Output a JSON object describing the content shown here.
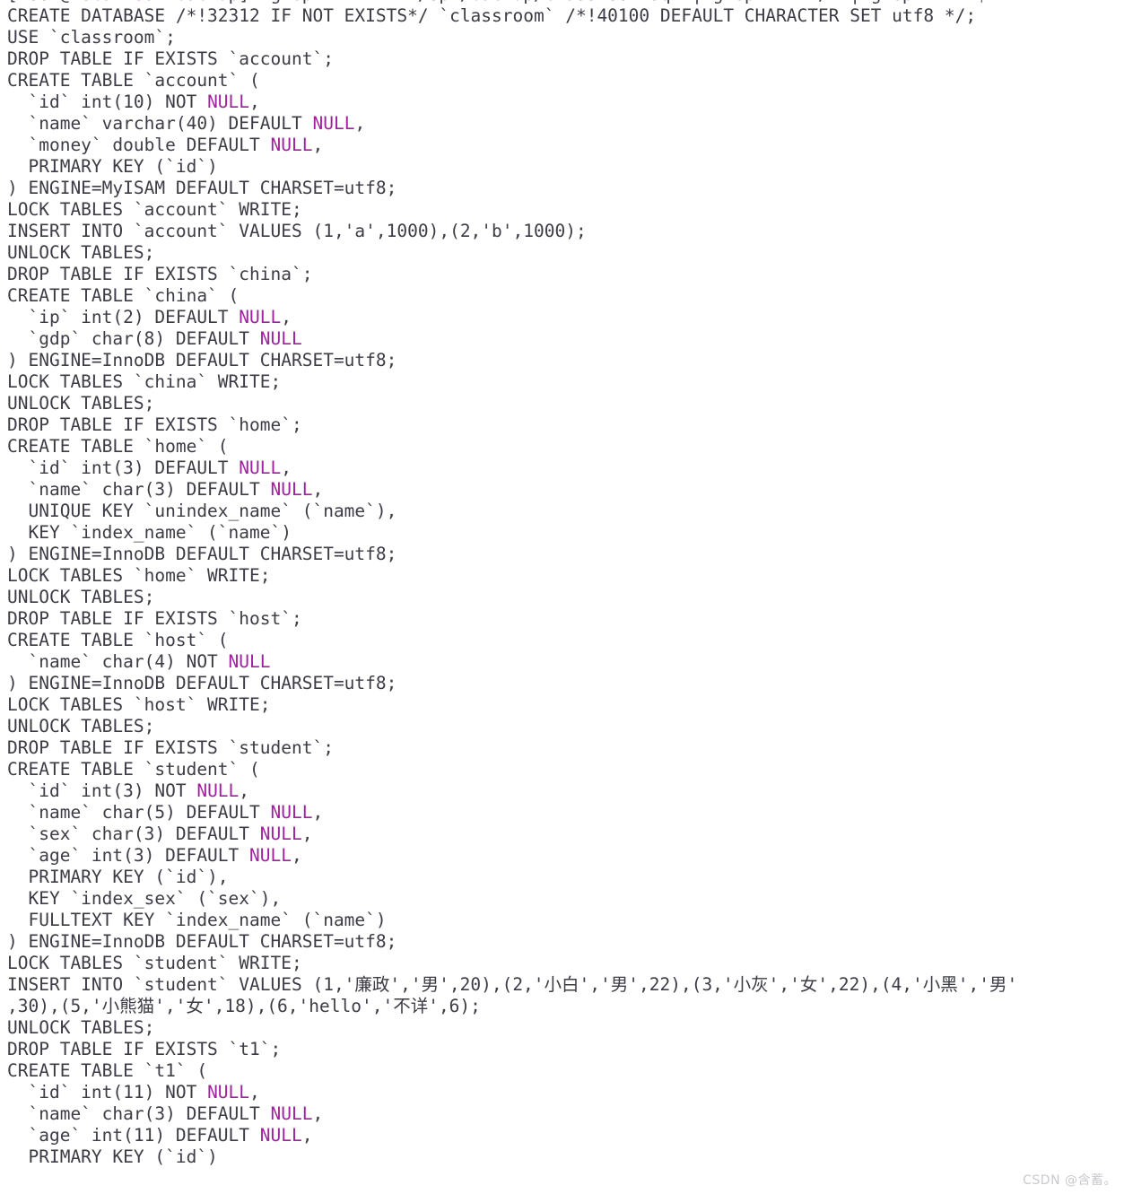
{
  "terminal": {
    "colors": {
      "background": "#ffffff",
      "foreground": "#3c3c46",
      "keyword_magenta": "#a0219f",
      "watermark": "#c9c9cf"
    },
    "prompt": {
      "user": "root",
      "host": "localhost",
      "cwd": "backup",
      "symbol": "#",
      "full_prompt": "[root@localhost backup]# ",
      "command": "grep -v \"^--\" /opt/backup/classroom.sql | grep -v \"^/\" | grep -v \"^$\""
    },
    "clipped_top_line": "",
    "lines": [
      {
        "text": "[root@localhost backup]# grep -v \"^--\" /opt/backup/classroom.sql | grep -v \"^/\" | grep -v \"^$\"",
        "highlight": [
          "localhost"
        ]
      },
      {
        "text": "CREATE DATABASE /*!32312 IF NOT EXISTS*/ `classroom` /*!40100 DEFAULT CHARACTER SET utf8 */;",
        "highlight": []
      },
      {
        "text": "USE `classroom`;",
        "highlight": []
      },
      {
        "text": "DROP TABLE IF EXISTS `account`;",
        "highlight": []
      },
      {
        "text": "CREATE TABLE `account` (",
        "highlight": []
      },
      {
        "text": "  `id` int(10) NOT NULL,",
        "highlight": [
          "NULL"
        ]
      },
      {
        "text": "  `name` varchar(40) DEFAULT NULL,",
        "highlight": [
          "NULL"
        ]
      },
      {
        "text": "  `money` double DEFAULT NULL,",
        "highlight": [
          "NULL"
        ]
      },
      {
        "text": "  PRIMARY KEY (`id`)",
        "highlight": []
      },
      {
        "text": ") ENGINE=MyISAM DEFAULT CHARSET=utf8;",
        "highlight": []
      },
      {
        "text": "LOCK TABLES `account` WRITE;",
        "highlight": []
      },
      {
        "text": "INSERT INTO `account` VALUES (1,'a',1000),(2,'b',1000);",
        "highlight": []
      },
      {
        "text": "UNLOCK TABLES;",
        "highlight": []
      },
      {
        "text": "DROP TABLE IF EXISTS `china`;",
        "highlight": []
      },
      {
        "text": "CREATE TABLE `china` (",
        "highlight": []
      },
      {
        "text": "  `ip` int(2) DEFAULT NULL,",
        "highlight": [
          "NULL"
        ]
      },
      {
        "text": "  `gdp` char(8) DEFAULT NULL",
        "highlight": [
          "NULL"
        ]
      },
      {
        "text": ") ENGINE=InnoDB DEFAULT CHARSET=utf8;",
        "highlight": []
      },
      {
        "text": "LOCK TABLES `china` WRITE;",
        "highlight": []
      },
      {
        "text": "UNLOCK TABLES;",
        "highlight": []
      },
      {
        "text": "DROP TABLE IF EXISTS `home`;",
        "highlight": []
      },
      {
        "text": "CREATE TABLE `home` (",
        "highlight": []
      },
      {
        "text": "  `id` int(3) DEFAULT NULL,",
        "highlight": [
          "NULL"
        ]
      },
      {
        "text": "  `name` char(3) DEFAULT NULL,",
        "highlight": [
          "NULL"
        ]
      },
      {
        "text": "  UNIQUE KEY `unindex_name` (`name`),",
        "highlight": []
      },
      {
        "text": "  KEY `index_name` (`name`)",
        "highlight": []
      },
      {
        "text": ") ENGINE=InnoDB DEFAULT CHARSET=utf8;",
        "highlight": []
      },
      {
        "text": "LOCK TABLES `home` WRITE;",
        "highlight": []
      },
      {
        "text": "UNLOCK TABLES;",
        "highlight": []
      },
      {
        "text": "DROP TABLE IF EXISTS `host`;",
        "highlight": []
      },
      {
        "text": "CREATE TABLE `host` (",
        "highlight": []
      },
      {
        "text": "  `name` char(4) NOT NULL",
        "highlight": [
          "NULL"
        ]
      },
      {
        "text": ") ENGINE=InnoDB DEFAULT CHARSET=utf8;",
        "highlight": []
      },
      {
        "text": "LOCK TABLES `host` WRITE;",
        "highlight": []
      },
      {
        "text": "UNLOCK TABLES;",
        "highlight": []
      },
      {
        "text": "DROP TABLE IF EXISTS `student`;",
        "highlight": []
      },
      {
        "text": "CREATE TABLE `student` (",
        "highlight": []
      },
      {
        "text": "  `id` int(3) NOT NULL,",
        "highlight": [
          "NULL"
        ]
      },
      {
        "text": "  `name` char(5) DEFAULT NULL,",
        "highlight": [
          "NULL"
        ]
      },
      {
        "text": "  `sex` char(3) DEFAULT NULL,",
        "highlight": [
          "NULL"
        ]
      },
      {
        "text": "  `age` int(3) DEFAULT NULL,",
        "highlight": [
          "NULL"
        ]
      },
      {
        "text": "  PRIMARY KEY (`id`),",
        "highlight": []
      },
      {
        "text": "  KEY `index_sex` (`sex`),",
        "highlight": []
      },
      {
        "text": "  FULLTEXT KEY `index_name` (`name`)",
        "highlight": []
      },
      {
        "text": ") ENGINE=InnoDB DEFAULT CHARSET=utf8;",
        "highlight": []
      },
      {
        "text": "LOCK TABLES `student` WRITE;",
        "highlight": []
      },
      {
        "text": "INSERT INTO `student` VALUES (1,'廉政','男',20),(2,'小白','男',22),(3,'小灰','女',22),(4,'小黑','男'",
        "highlight": []
      },
      {
        "text": ",30),(5,'小熊猫','女',18),(6,'hello','不详',6);",
        "highlight": []
      },
      {
        "text": "UNLOCK TABLES;",
        "highlight": []
      },
      {
        "text": "DROP TABLE IF EXISTS `t1`;",
        "highlight": []
      },
      {
        "text": "CREATE TABLE `t1` (",
        "highlight": []
      },
      {
        "text": "  `id` int(11) NOT NULL,",
        "highlight": [
          "NULL"
        ]
      },
      {
        "text": "  `name` char(3) DEFAULT NULL,",
        "highlight": [
          "NULL"
        ]
      },
      {
        "text": "  `age` int(11) DEFAULT NULL,",
        "highlight": [
          "NULL"
        ]
      },
      {
        "text": "  PRIMARY KEY (`id`)",
        "highlight": []
      }
    ]
  },
  "watermark": {
    "text": "CSDN @含蓄。"
  }
}
